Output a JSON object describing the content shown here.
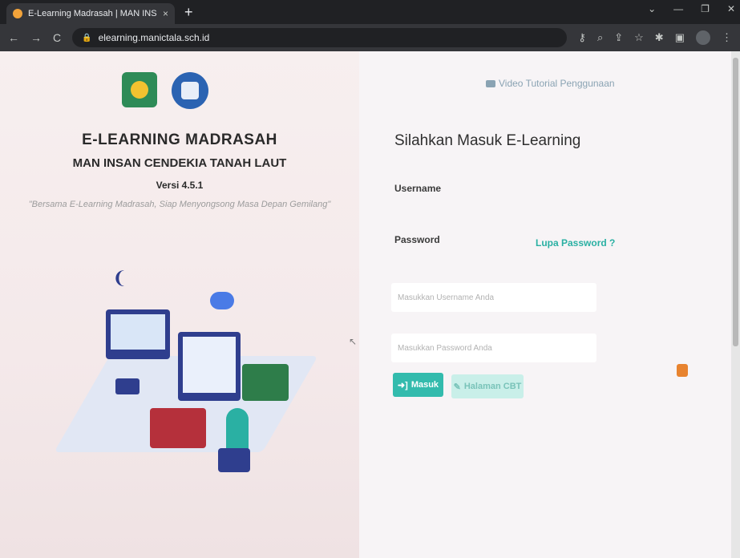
{
  "browser": {
    "tab_title": "E-Learning Madrasah | MAN INS",
    "tab_close": "×",
    "new_tab": "+",
    "window_controls": [
      "⌄",
      "—",
      "❐",
      "✕"
    ],
    "nav": {
      "back": "←",
      "forward": "→",
      "reload": "C"
    },
    "url": "elearning.manictala.sch.id"
  },
  "left": {
    "title": "E-LEARNING MADRASAH",
    "school": "MAN INSAN CENDEKIA TANAH LAUT",
    "version": "Versi 4.5.1",
    "tagline": "\"Bersama E-Learning Madrasah, Siap Menyongsong Masa Depan Gemilang\""
  },
  "right": {
    "video_link": "Video Tutorial Penggunaan",
    "login_title": "Silahkan Masuk E-Learning",
    "username_label": "Username",
    "username_placeholder": "Masukkan Username Anda",
    "password_label": "Password",
    "forgot_password": "Lupa Password ?",
    "password_placeholder": "Masukkan Password Anda",
    "login_button": "Masuk",
    "cbt_button": "Halaman CBT"
  },
  "colors": {
    "accent": "#33bbad",
    "accent_light": "#c9efe9",
    "chrome_dark": "#202124"
  },
  "icons": [
    "wifi-icon",
    "camera-icon",
    "login-icon",
    "edit-icon",
    "lock-icon",
    "key-icon",
    "search-icon",
    "share-icon",
    "star-icon",
    "extensions-icon",
    "sidepanel-icon",
    "profile-icon",
    "menu-icon"
  ]
}
